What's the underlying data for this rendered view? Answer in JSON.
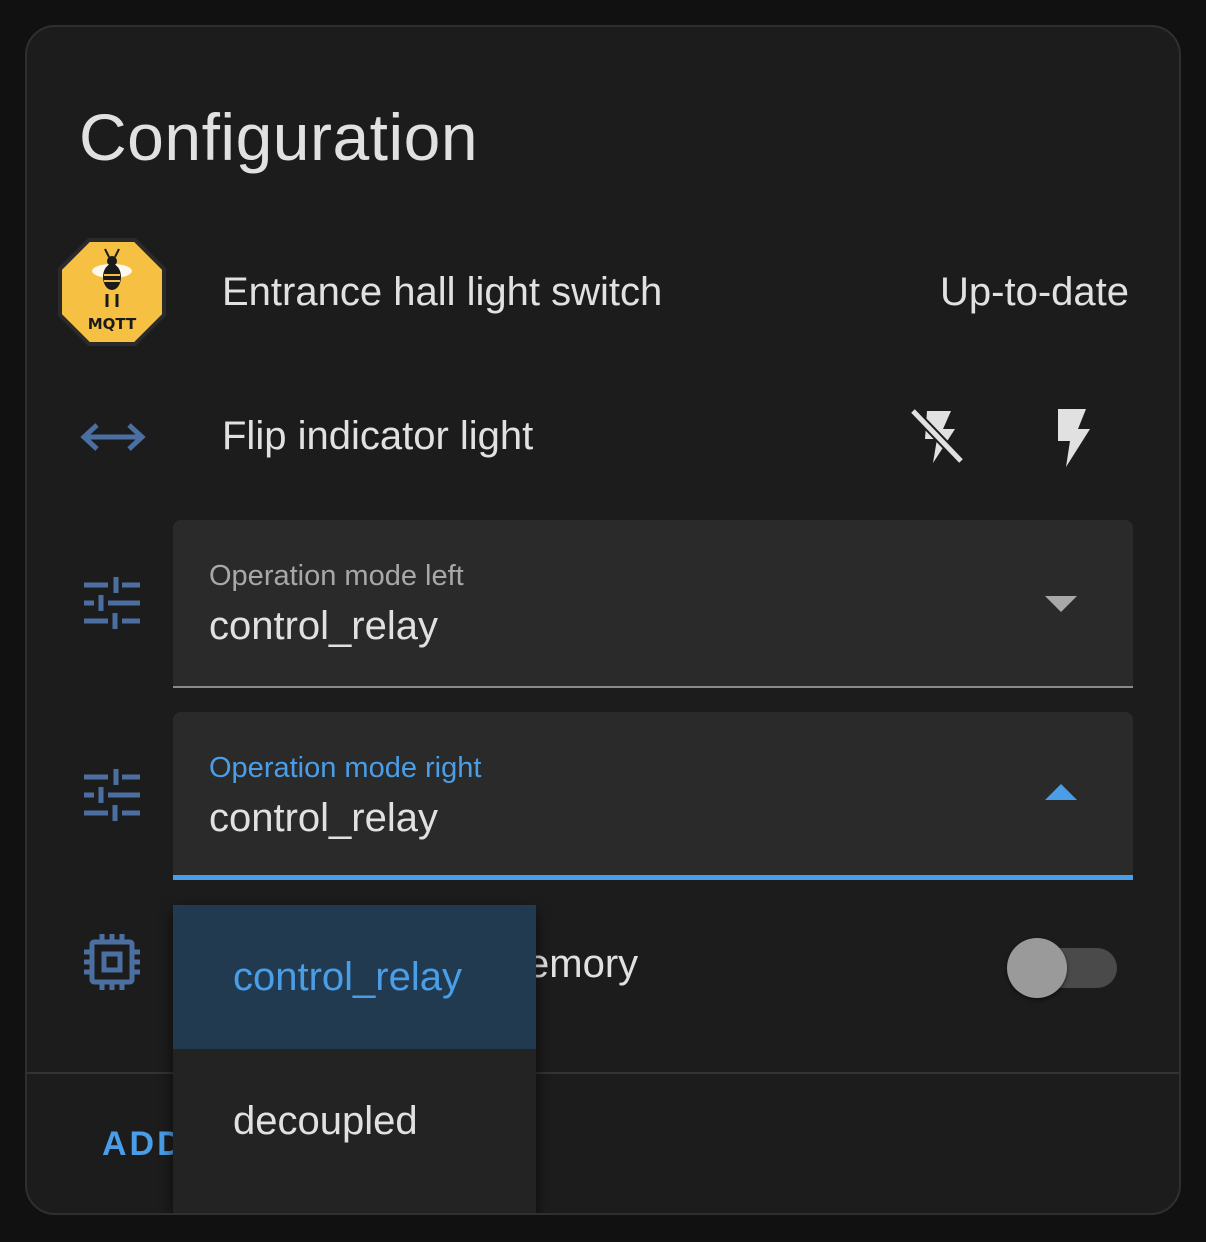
{
  "card": {
    "title": "Configuration"
  },
  "device": {
    "name": "Entrance hall light switch",
    "status": "Up-to-date",
    "logo_text": "MQTT"
  },
  "flip": {
    "label": "Flip indicator light"
  },
  "select_left": {
    "label": "Operation mode left",
    "value": "control_relay"
  },
  "select_right": {
    "label": "Operation mode right",
    "value": "control_relay"
  },
  "memory": {
    "label_visible": "emory",
    "toggle_on": false
  },
  "footer": {
    "add_label_visible": "ADD"
  },
  "dropdown": {
    "options": [
      {
        "label": "control_relay",
        "selected": true
      },
      {
        "label": "decoupled",
        "selected": false
      }
    ]
  },
  "colors": {
    "accent": "#4a9ee8",
    "icon_blue": "#4a6fa0",
    "background": "#1c1c1c",
    "field_bg": "#2a2a2a",
    "logo_yellow": "#f6c043"
  },
  "icons": [
    "mqtt-logo",
    "swap-horizontal-icon",
    "flash-off-icon",
    "flash-icon",
    "tune-icon",
    "chip-icon"
  ]
}
